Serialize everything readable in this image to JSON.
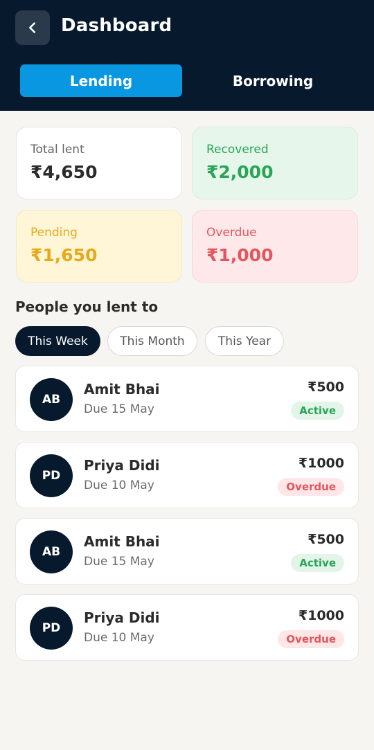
{
  "header": {
    "title": "Dashboard",
    "back_icon": "chevron-left-icon",
    "tabs": [
      {
        "label": "Lending",
        "active": true
      },
      {
        "label": "Borrowing",
        "active": false
      }
    ]
  },
  "summary": {
    "total": {
      "label": "Total lent",
      "value": "₹4,650"
    },
    "recovered": {
      "label": "Recovered",
      "value": "₹2,000"
    },
    "pending": {
      "label": "Pending",
      "value": "₹1,650"
    },
    "overdue": {
      "label": "Overdue",
      "value": "₹1,000"
    }
  },
  "people": {
    "title": "People you lent to",
    "filters": [
      {
        "label": "This Week",
        "active": true
      },
      {
        "label": "This Month",
        "active": false
      },
      {
        "label": "This Year",
        "active": false
      }
    ],
    "items": [
      {
        "initials": "AB",
        "name": "Amit Bhai",
        "due": "Due 15 May",
        "amount": "₹500",
        "status": "Active"
      },
      {
        "initials": "PD",
        "name": "Priya Didi",
        "due": "Due 10 May",
        "amount": "₹1000",
        "status": "Overdue"
      },
      {
        "initials": "AB",
        "name": "Amit Bhai",
        "due": "Due 15 May",
        "amount": "₹500",
        "status": "Active"
      },
      {
        "initials": "PD",
        "name": "Priya Didi",
        "due": "Due 10 May",
        "amount": "₹1000",
        "status": "Overdue"
      }
    ]
  },
  "colors": {
    "header_bg": "#071a2d",
    "accent": "#0a97e2",
    "success": "#2aa457",
    "warning": "#e6a91a",
    "danger": "#e0575e"
  }
}
